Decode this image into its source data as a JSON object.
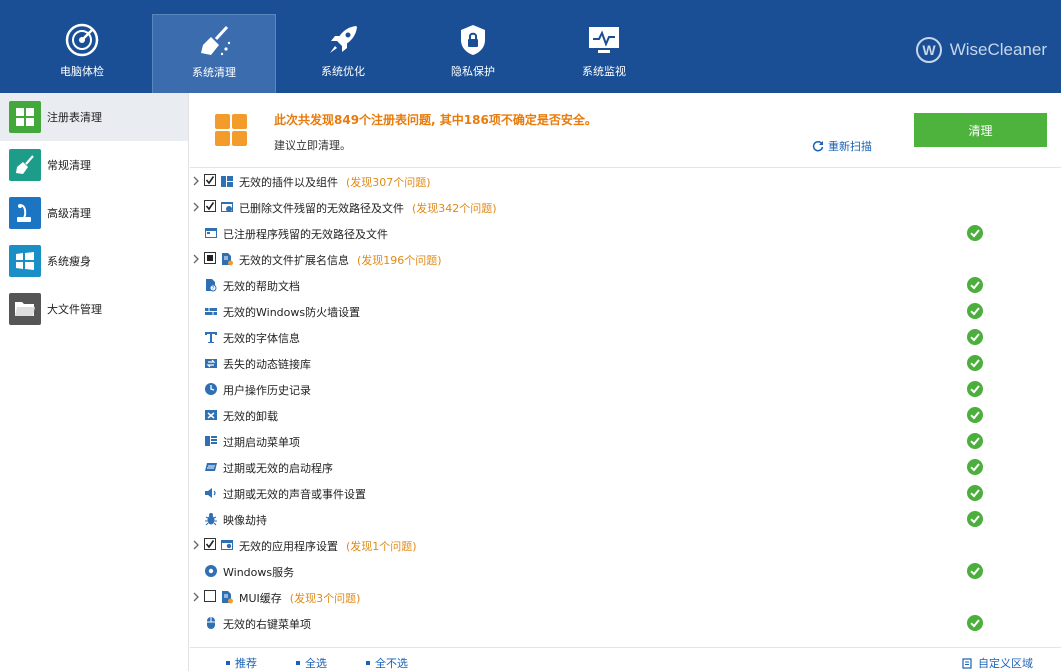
{
  "nav": {
    "tabs": [
      {
        "label": "电脑体检",
        "icon": "radar-icon"
      },
      {
        "label": "系统清理",
        "icon": "broom-icon",
        "active": true
      },
      {
        "label": "系统优化",
        "icon": "rocket-icon"
      },
      {
        "label": "隐私保护",
        "icon": "shield-lock-icon"
      },
      {
        "label": "系统监视",
        "icon": "monitor-pulse-icon"
      }
    ],
    "brand": "WiseCleaner"
  },
  "sidebar": {
    "items": [
      {
        "label": "注册表清理",
        "icon": "registry-grid-icon",
        "color": "#43a83a",
        "active": true
      },
      {
        "label": "常规清理",
        "icon": "broom-icon",
        "color": "#1e9c8a"
      },
      {
        "label": "高级清理",
        "icon": "vacuum-icon",
        "color": "#1b75c2"
      },
      {
        "label": "系统瘦身",
        "icon": "windows-icon",
        "color": "#1a8fc6"
      },
      {
        "label": "大文件管理",
        "icon": "folder-icon",
        "color": "#555555"
      }
    ]
  },
  "header": {
    "summary": "此次共发现849个注册表问题, 其中186项不确定是否安全。",
    "advice": "建议立即清理。",
    "rescan": "重新扫描",
    "clean_button": "清理"
  },
  "colors": {
    "accent_blue": "#1a4f96",
    "clean_green": "#4db33d",
    "warning_orange": "#e87b0c",
    "ok_green": "#4cae3c"
  },
  "rows": [
    {
      "label": "无效的插件以及组件",
      "found": "(发现307个问题)",
      "expand": true,
      "check": "checked",
      "icon": "plugin-icon"
    },
    {
      "label": "已删除文件残留的无效路径及文件",
      "found": "(发现342个问题)",
      "expand": true,
      "check": "checked",
      "icon": "deleted-file-icon"
    },
    {
      "label": "已注册程序残留的无效路径及文件",
      "found": "",
      "expand": false,
      "check": "none",
      "icon": "program-window-icon",
      "ok": true
    },
    {
      "label": "无效的文件扩展名信息",
      "found": "(发现196个问题)",
      "expand": true,
      "check": "partial",
      "icon": "file-warning-icon"
    },
    {
      "label": "无效的帮助文档",
      "found": "",
      "expand": false,
      "check": "none",
      "icon": "help-doc-icon",
      "ok": true
    },
    {
      "label": "无效的Windows防火墙设置",
      "found": "",
      "expand": false,
      "check": "none",
      "icon": "firewall-icon",
      "ok": true
    },
    {
      "label": "无效的字体信息",
      "found": "",
      "expand": false,
      "check": "none",
      "icon": "font-icon",
      "ok": true
    },
    {
      "label": "丢失的动态链接库",
      "found": "",
      "expand": false,
      "check": "none",
      "icon": "dll-icon",
      "ok": true
    },
    {
      "label": "用户操作历史记录",
      "found": "",
      "expand": false,
      "check": "none",
      "icon": "clock-icon",
      "ok": true
    },
    {
      "label": "无效的卸载",
      "found": "",
      "expand": false,
      "check": "none",
      "icon": "uninstall-icon",
      "ok": true
    },
    {
      "label": "过期启动菜单项",
      "found": "",
      "expand": false,
      "check": "none",
      "icon": "start-menu-icon",
      "ok": true
    },
    {
      "label": "过期或无效的启动程序",
      "found": "",
      "expand": false,
      "check": "none",
      "icon": "startup-icon",
      "ok": true
    },
    {
      "label": "过期或无效的声音或事件设置",
      "found": "",
      "expand": false,
      "check": "none",
      "icon": "speaker-icon",
      "ok": true
    },
    {
      "label": "映像劫持",
      "found": "",
      "expand": false,
      "check": "none",
      "icon": "bug-icon",
      "ok": true
    },
    {
      "label": "无效的应用程序设置",
      "found": "(发现1个问题)",
      "expand": true,
      "check": "checked",
      "icon": "app-settings-icon"
    },
    {
      "label": "Windows服务",
      "found": "",
      "expand": false,
      "check": "none",
      "icon": "gear-icon",
      "ok": true
    },
    {
      "label": "MUI缓存",
      "found": "(发现3个问题)",
      "expand": true,
      "check": "unchecked",
      "icon": "file-warning-icon"
    },
    {
      "label": "无效的右键菜单项",
      "found": "",
      "expand": false,
      "check": "none",
      "icon": "mouse-icon",
      "ok": true
    }
  ],
  "footer": {
    "recommend": "推荐",
    "select_all": "全选",
    "select_none": "全不选",
    "custom_area": "自定义区域"
  }
}
